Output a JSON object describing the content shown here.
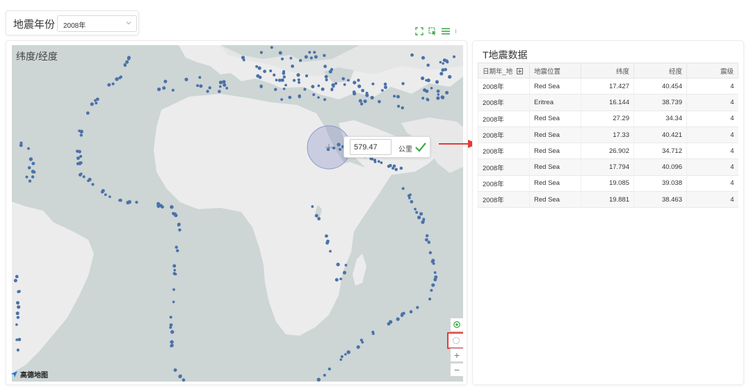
{
  "filter": {
    "label": "地震年份",
    "selected": "2008年",
    "chevron_icon": "chevron-down-icon"
  },
  "toolbar": {
    "icons": [
      "fullscreen-icon",
      "box-select-icon",
      "list-icon",
      "more-vertical-icon"
    ],
    "color": "#3bab4a"
  },
  "map": {
    "title": "纬度/经度",
    "provider_logo": "高德地图",
    "measure": {
      "value": "579.47",
      "unit": "公里",
      "confirm_icon": "check-icon"
    },
    "controls": [
      "locate-icon",
      "lasso-select-icon",
      "zoom-in-icon",
      "zoom-out-icon"
    ],
    "zoom_in_label": "+",
    "zoom_out_label": "−",
    "point_color": "#4a72a8",
    "land_color": "#ececec",
    "water_color": "#cdd5d5"
  },
  "table": {
    "title": "T地震数据",
    "columns": [
      "日期年_地",
      "地震位置",
      "纬度",
      "经度",
      "震级"
    ],
    "rows": [
      [
        "2008年",
        "Red Sea",
        "17.427",
        "40.454",
        "4"
      ],
      [
        "2008年",
        "Eritrea",
        "16.144",
        "38.739",
        "4"
      ],
      [
        "2008年",
        "Red Sea",
        "27.29",
        "34.34",
        "4"
      ],
      [
        "2008年",
        "Red Sea",
        "17.33",
        "40.421",
        "4"
      ],
      [
        "2008年",
        "Red Sea",
        "26.902",
        "34.712",
        "4"
      ],
      [
        "2008年",
        "Red Sea",
        "17.794",
        "40.096",
        "4"
      ],
      [
        "2008年",
        "Red Sea",
        "19.085",
        "39.038",
        "4"
      ],
      [
        "2008年",
        "Red Sea",
        "19.881",
        "38.463",
        "4"
      ]
    ]
  }
}
